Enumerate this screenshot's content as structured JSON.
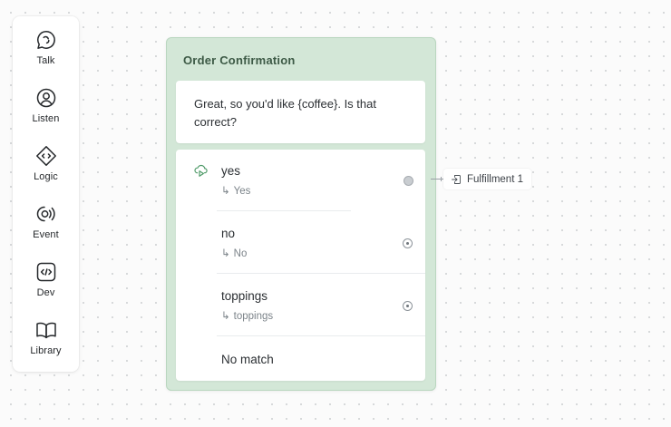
{
  "toolbar": {
    "items": [
      {
        "label": "Talk",
        "icon": "talk-icon"
      },
      {
        "label": "Listen",
        "icon": "listen-icon"
      },
      {
        "label": "Logic",
        "icon": "logic-icon"
      },
      {
        "label": "Event",
        "icon": "event-icon"
      },
      {
        "label": "Dev",
        "icon": "dev-icon"
      },
      {
        "label": "Library",
        "icon": "library-icon"
      }
    ]
  },
  "block": {
    "title": "Order Confirmation",
    "speak_text": "Great, so you'd like {coffee}. Is that correct?",
    "choice_icon": "choice-icon",
    "paths": [
      {
        "name": "yes",
        "intent": "Yes",
        "connected": true
      },
      {
        "name": "no",
        "intent": "No",
        "connected": false
      },
      {
        "name": "toppings",
        "intent": "toppings",
        "connected": false
      }
    ],
    "no_match": "No match"
  },
  "target": {
    "label": "Fulfillment 1",
    "icon": "go-to-block-icon"
  },
  "colors": {
    "block_bg": "#d3e7d7",
    "block_title": "#3d5a46",
    "choice_icon": "#4f9a68",
    "canvas": "#fbfbfb"
  },
  "glyphs": {
    "subpath_arrow": "↳"
  }
}
